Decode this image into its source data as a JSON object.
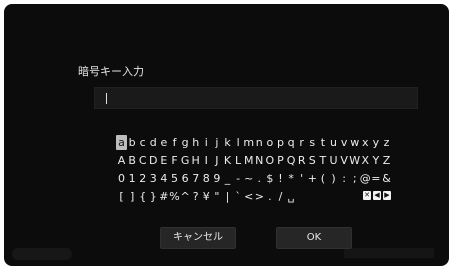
{
  "dialog": {
    "title": "暗号キー入力",
    "input_value": ""
  },
  "keyboard": {
    "rows": [
      [
        "a",
        "b",
        "c",
        "d",
        "e",
        "f",
        "g",
        "h",
        "i",
        "j",
        "k",
        "l",
        "m",
        "n",
        "o",
        "p",
        "q",
        "r",
        "s",
        "t",
        "u",
        "v",
        "w",
        "x",
        "y",
        "z"
      ],
      [
        "A",
        "B",
        "C",
        "D",
        "E",
        "F",
        "G",
        "H",
        "I",
        "J",
        "K",
        "L",
        "M",
        "N",
        "O",
        "P",
        "Q",
        "R",
        "S",
        "T",
        "U",
        "V",
        "W",
        "X",
        "Y",
        "Z"
      ],
      [
        "0",
        "1",
        "2",
        "3",
        "4",
        "5",
        "6",
        "7",
        "8",
        "9",
        "_",
        "-",
        "~",
        ".",
        "$",
        "!",
        "*",
        "'",
        "+",
        "(",
        ")",
        ":",
        ";",
        "@",
        "=",
        "&"
      ],
      [
        "[",
        "]",
        "{",
        "}",
        "#",
        "%",
        "^",
        "?",
        "¥",
        "\"",
        "|",
        "`",
        "<",
        ">",
        ".",
        "/",
        "␣"
      ]
    ],
    "selected_key": "a",
    "controls": [
      "delete-icon",
      "arrow-left-icon",
      "arrow-right-icon"
    ]
  },
  "buttons": {
    "cancel_label": "キャンセル",
    "ok_label": "OK"
  },
  "colors": {
    "background": "#0c0c0c",
    "text": "#ececec",
    "selected_key": "#bdbdbd",
    "button": "#262626"
  }
}
